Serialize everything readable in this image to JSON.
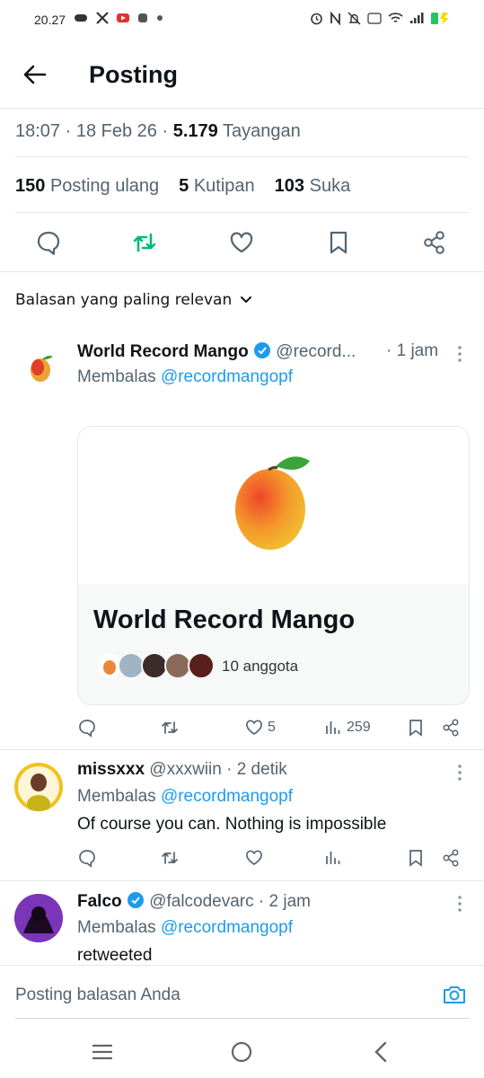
{
  "status_bar": {
    "time": "20.27"
  },
  "header": {
    "title": "Posting"
  },
  "post_meta": {
    "time": "18:07",
    "date": "18 Feb 26",
    "views_count": "5.179",
    "views_label": "Tayangan"
  },
  "post_stats": {
    "reposts_count": "150",
    "reposts_label": "Posting ulang",
    "quotes_count": "5",
    "quotes_label": "Kutipan",
    "likes_count": "103",
    "likes_label": "Suka"
  },
  "sort": {
    "label": "Balasan yang paling relevan"
  },
  "replies": [
    {
      "name": "World Record Mango",
      "handle": "@record...",
      "time": "· 1 jam",
      "replying_prefix": "Membalas",
      "replying_to": "@recordmangopf",
      "text": "",
      "community": {
        "title": "World Record Mango",
        "members": "10 anggota"
      },
      "stats": {
        "likes": "5",
        "views": "259"
      }
    },
    {
      "name": "missxxx",
      "handle": "@xxxwiin",
      "time": "· 2 detik",
      "replying_prefix": "Membalas",
      "replying_to": "@recordmangopf",
      "text": "Of course you can. Nothing is impossible"
    },
    {
      "name": "Falco",
      "handle": "@falcodevarc",
      "time": "· 2 jam",
      "replying_prefix": "Membalas",
      "replying_to": "@recordmangopf",
      "text": "retweeted"
    }
  ],
  "reply_bar": {
    "placeholder": "Posting balasan Anda"
  },
  "colors": {
    "accent": "#1d9bf0",
    "repost_active": "#00ba7c",
    "text": "#0f1419",
    "muted": "#536471"
  }
}
